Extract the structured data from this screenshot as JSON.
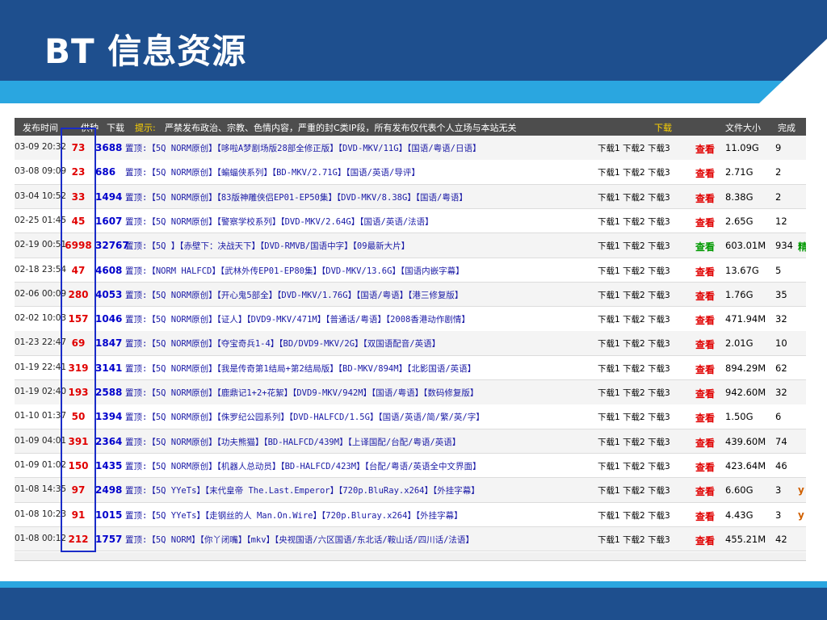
{
  "slide": {
    "title": "BT 信息资源"
  },
  "table": {
    "header": {
      "time": "发布时间",
      "seed": "供种",
      "download": "下载",
      "hint": "提示:",
      "notice": "严禁发布政治、宗教、色情内容，严重的封C类IP段，所有发布仅代表个人立场与本站无关",
      "links": "下载",
      "size": "文件大小",
      "done": "完成"
    },
    "rows": [
      {
        "time": "03-09 20:32",
        "seed": "73",
        "dl": "3688",
        "title": "置顶:【5Q NORM原创】【哆啦A梦剧场版28部全修正版】【DVD-MKV/11G】【国语/粤语/日语】",
        "links": "下载1 下载2 下载3",
        "view": "查看",
        "size": "11.09G",
        "done": "9",
        "extra": ""
      },
      {
        "time": "03-08 09:09",
        "seed": "23",
        "dl": "686",
        "title": "置顶:【5Q NORM原创】【蝙蝠侠系列】【BD-MKV/2.71G】【国语/英语/导评】",
        "links": "下载1 下载2 下载3",
        "view": "查看",
        "size": "2.71G",
        "done": "2",
        "extra": ""
      },
      {
        "time": "03-04 10:52",
        "seed": "33",
        "dl": "1494",
        "title": "置顶:【5Q NORM原创】【83版神雕侠侣EP01-EP50集】【DVD-MKV/8.38G】【国语/粤语】",
        "links": "下载1 下载2 下载3",
        "view": "查看",
        "size": "8.38G",
        "done": "2",
        "extra": ""
      },
      {
        "time": "02-25 01:45",
        "seed": "45",
        "dl": "1607",
        "title": "置顶:【5Q NORM原创】【警察学校系列】【DVD-MKV/2.64G】【国语/英语/法语】",
        "links": "下载1 下载2 下载3",
        "view": "查看",
        "size": "2.65G",
        "done": "12",
        "extra": ""
      },
      {
        "time": "02-19 00:51",
        "seed": "6998",
        "dl": "32767",
        "title": "置顶:【5Q 】【赤壁下：决战天下】【DVD-RMVB/国语中字】【09最新大片】",
        "links": "下载1 下载2 下载3",
        "view": "查看",
        "size": "603.01M",
        "done": "934",
        "extra": "精",
        "view_green": true
      },
      {
        "time": "02-18 23:54",
        "seed": "47",
        "dl": "4608",
        "title": "置顶:【NORM HALFCD】【武林外传EP01-EP80集】【DVD-MKV/13.6G】【国语内嵌字幕】",
        "links": "下载1 下载2 下载3",
        "view": "查看",
        "size": "13.67G",
        "done": "5",
        "extra": ""
      },
      {
        "time": "02-06 00:09",
        "seed": "280",
        "dl": "4053",
        "title": "置顶:【5Q NORM原创】【开心鬼5部全】【DVD-MKV/1.76G】【国语/粤语】【港三修复版】",
        "links": "下载1 下载2 下载3",
        "view": "查看",
        "size": "1.76G",
        "done": "35",
        "extra": ""
      },
      {
        "time": "02-02 10:03",
        "seed": "157",
        "dl": "1046",
        "title": "置顶:【5Q NORM原创】【证人】【DVD9-MKV/471M】【普通话/粤语】【2008香港动作剧情】",
        "links": "下载1 下载2 下载3",
        "view": "查看",
        "size": "471.94M",
        "done": "32",
        "extra": ""
      },
      {
        "time": "01-23 22:47",
        "seed": "69",
        "dl": "1847",
        "title": "置顶:【5Q NORM原创】【夺宝奇兵1-4】【BD/DVD9-MKV/2G】【双国语配音/英语】",
        "links": "下载1 下载2 下载3",
        "view": "查看",
        "size": "2.01G",
        "done": "10",
        "extra": ""
      },
      {
        "time": "01-19 22:41",
        "seed": "319",
        "dl": "3141",
        "title": "置顶:【5Q NORM原创】【我是传奇第1结局+第2结局版】【BD-MKV/894M】【北影国语/英语】",
        "links": "下载1 下载2 下载3",
        "view": "查看",
        "size": "894.29M",
        "done": "62",
        "extra": ""
      },
      {
        "time": "01-19 02:40",
        "seed": "193",
        "dl": "2588",
        "title": "置顶:【5Q NORM原创】【鹿鼎记1+2+花絮】【DVD9-MKV/942M】【国语/粤语】【数码修复版】",
        "links": "下载1 下载2 下载3",
        "view": "查看",
        "size": "942.60M",
        "done": "32",
        "extra": ""
      },
      {
        "time": "01-10 01:37",
        "seed": "50",
        "dl": "1394",
        "title": "置顶:【5Q NORM原创】【侏罗纪公园系列】【DVD-HALFCD/1.5G】【国语/英语/简/繁/英/字】",
        "links": "下载1 下载2 下载3",
        "view": "查看",
        "size": "1.50G",
        "done": "6",
        "extra": ""
      },
      {
        "time": "01-09 04:01",
        "seed": "391",
        "dl": "2364",
        "title": "置顶:【5Q NORM原创】【功夫熊猫】【BD-HALFCD/439M】【上译国配/台配/粤语/英语】",
        "links": "下载1 下载2 下载3",
        "view": "查看",
        "size": "439.60M",
        "done": "74",
        "extra": ""
      },
      {
        "time": "01-09 01:02",
        "seed": "150",
        "dl": "1435",
        "title": "置顶:【5Q NORM原创】【机器人总动员】【BD-HALFCD/423M】【台配/粤语/英语全中文界面】",
        "links": "下载1 下载2 下载3",
        "view": "查看",
        "size": "423.64M",
        "done": "46",
        "extra": ""
      },
      {
        "time": "01-08 14:35",
        "seed": "97",
        "dl": "2498",
        "title": "置顶:【5Q YYeTs】【末代皇帝 The.Last.Emperor】【720p.BluRay.x264】【外挂字幕】",
        "links": "下载1 下载2 下载3",
        "view": "查看",
        "size": "6.60G",
        "done": "3",
        "extra": "y"
      },
      {
        "time": "01-08 10:23",
        "seed": "91",
        "dl": "1015",
        "title": "置顶:【5Q YYeTs】【走钢丝的人 Man.On.Wire】【720p.Bluray.x264】【外挂字幕】",
        "links": "下载1 下载2 下载3",
        "view": "查看",
        "size": "4.43G",
        "done": "3",
        "extra": "y"
      },
      {
        "time": "01-08 00:12",
        "seed": "212",
        "dl": "1757",
        "title": "置顶:【5Q NORM】【你丫闭嘴】【mkv】【央视国语/六区国语/东北话/鞍山话/四川话/法语】",
        "links": "下载1 下载2 下载3",
        "view": "查看",
        "size": "455.21M",
        "done": "42",
        "extra": ""
      }
    ]
  }
}
